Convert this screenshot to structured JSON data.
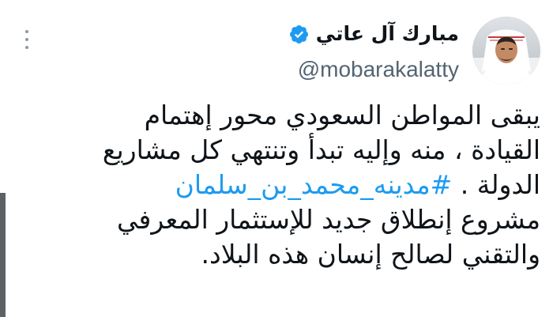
{
  "tweet": {
    "author": {
      "display_name": "مبارك آل عاتي",
      "handle": "@mobarakalatty",
      "verified_icon": "verified-badge-icon",
      "avatar_icon": "profile-photo"
    },
    "more_icon": "more-options-icon",
    "body": {
      "line_1": "يبقى المواطن السعودي محور إهتمام",
      "line_2": "القيادة ، منه وإليه تبدأ وتنتهي كل مشاريع",
      "line_3_text": "الدولة .",
      "line_3_hashtag": "#مدينه_محمد_بن_سلمان",
      "line_4": "مشروع إنطلاق جديد للإستثمار المعرفي",
      "line_5": "والتقني لصالح إنسان هذه البلاد."
    }
  },
  "colors": {
    "text_primary": "#0f1419",
    "text_secondary": "#536471",
    "accent": "#1d9bf0",
    "icon_muted": "#8b98a5"
  }
}
